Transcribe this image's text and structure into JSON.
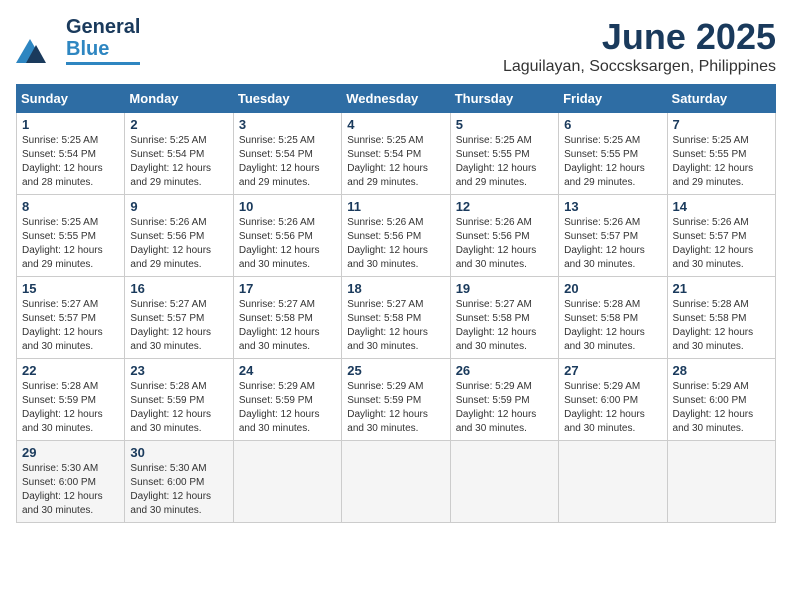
{
  "header": {
    "logo_line1": "General",
    "logo_line2": "Blue",
    "month": "June 2025",
    "location": "Laguilayan, Soccsksargen, Philippines"
  },
  "weekdays": [
    "Sunday",
    "Monday",
    "Tuesday",
    "Wednesday",
    "Thursday",
    "Friday",
    "Saturday"
  ],
  "weeks": [
    [
      {
        "day": "1",
        "info": "Sunrise: 5:25 AM\nSunset: 5:54 PM\nDaylight: 12 hours\nand 28 minutes."
      },
      {
        "day": "2",
        "info": "Sunrise: 5:25 AM\nSunset: 5:54 PM\nDaylight: 12 hours\nand 29 minutes."
      },
      {
        "day": "3",
        "info": "Sunrise: 5:25 AM\nSunset: 5:54 PM\nDaylight: 12 hours\nand 29 minutes."
      },
      {
        "day": "4",
        "info": "Sunrise: 5:25 AM\nSunset: 5:54 PM\nDaylight: 12 hours\nand 29 minutes."
      },
      {
        "day": "5",
        "info": "Sunrise: 5:25 AM\nSunset: 5:55 PM\nDaylight: 12 hours\nand 29 minutes."
      },
      {
        "day": "6",
        "info": "Sunrise: 5:25 AM\nSunset: 5:55 PM\nDaylight: 12 hours\nand 29 minutes."
      },
      {
        "day": "7",
        "info": "Sunrise: 5:25 AM\nSunset: 5:55 PM\nDaylight: 12 hours\nand 29 minutes."
      }
    ],
    [
      {
        "day": "8",
        "info": "Sunrise: 5:25 AM\nSunset: 5:55 PM\nDaylight: 12 hours\nand 29 minutes."
      },
      {
        "day": "9",
        "info": "Sunrise: 5:26 AM\nSunset: 5:56 PM\nDaylight: 12 hours\nand 29 minutes."
      },
      {
        "day": "10",
        "info": "Sunrise: 5:26 AM\nSunset: 5:56 PM\nDaylight: 12 hours\nand 30 minutes."
      },
      {
        "day": "11",
        "info": "Sunrise: 5:26 AM\nSunset: 5:56 PM\nDaylight: 12 hours\nand 30 minutes."
      },
      {
        "day": "12",
        "info": "Sunrise: 5:26 AM\nSunset: 5:56 PM\nDaylight: 12 hours\nand 30 minutes."
      },
      {
        "day": "13",
        "info": "Sunrise: 5:26 AM\nSunset: 5:57 PM\nDaylight: 12 hours\nand 30 minutes."
      },
      {
        "day": "14",
        "info": "Sunrise: 5:26 AM\nSunset: 5:57 PM\nDaylight: 12 hours\nand 30 minutes."
      }
    ],
    [
      {
        "day": "15",
        "info": "Sunrise: 5:27 AM\nSunset: 5:57 PM\nDaylight: 12 hours\nand 30 minutes."
      },
      {
        "day": "16",
        "info": "Sunrise: 5:27 AM\nSunset: 5:57 PM\nDaylight: 12 hours\nand 30 minutes."
      },
      {
        "day": "17",
        "info": "Sunrise: 5:27 AM\nSunset: 5:58 PM\nDaylight: 12 hours\nand 30 minutes."
      },
      {
        "day": "18",
        "info": "Sunrise: 5:27 AM\nSunset: 5:58 PM\nDaylight: 12 hours\nand 30 minutes."
      },
      {
        "day": "19",
        "info": "Sunrise: 5:27 AM\nSunset: 5:58 PM\nDaylight: 12 hours\nand 30 minutes."
      },
      {
        "day": "20",
        "info": "Sunrise: 5:28 AM\nSunset: 5:58 PM\nDaylight: 12 hours\nand 30 minutes."
      },
      {
        "day": "21",
        "info": "Sunrise: 5:28 AM\nSunset: 5:58 PM\nDaylight: 12 hours\nand 30 minutes."
      }
    ],
    [
      {
        "day": "22",
        "info": "Sunrise: 5:28 AM\nSunset: 5:59 PM\nDaylight: 12 hours\nand 30 minutes."
      },
      {
        "day": "23",
        "info": "Sunrise: 5:28 AM\nSunset: 5:59 PM\nDaylight: 12 hours\nand 30 minutes."
      },
      {
        "day": "24",
        "info": "Sunrise: 5:29 AM\nSunset: 5:59 PM\nDaylight: 12 hours\nand 30 minutes."
      },
      {
        "day": "25",
        "info": "Sunrise: 5:29 AM\nSunset: 5:59 PM\nDaylight: 12 hours\nand 30 minutes."
      },
      {
        "day": "26",
        "info": "Sunrise: 5:29 AM\nSunset: 5:59 PM\nDaylight: 12 hours\nand 30 minutes."
      },
      {
        "day": "27",
        "info": "Sunrise: 5:29 AM\nSunset: 6:00 PM\nDaylight: 12 hours\nand 30 minutes."
      },
      {
        "day": "28",
        "info": "Sunrise: 5:29 AM\nSunset: 6:00 PM\nDaylight: 12 hours\nand 30 minutes."
      }
    ],
    [
      {
        "day": "29",
        "info": "Sunrise: 5:30 AM\nSunset: 6:00 PM\nDaylight: 12 hours\nand 30 minutes."
      },
      {
        "day": "30",
        "info": "Sunrise: 5:30 AM\nSunset: 6:00 PM\nDaylight: 12 hours\nand 30 minutes."
      },
      {
        "day": "",
        "info": ""
      },
      {
        "day": "",
        "info": ""
      },
      {
        "day": "",
        "info": ""
      },
      {
        "day": "",
        "info": ""
      },
      {
        "day": "",
        "info": ""
      }
    ]
  ]
}
